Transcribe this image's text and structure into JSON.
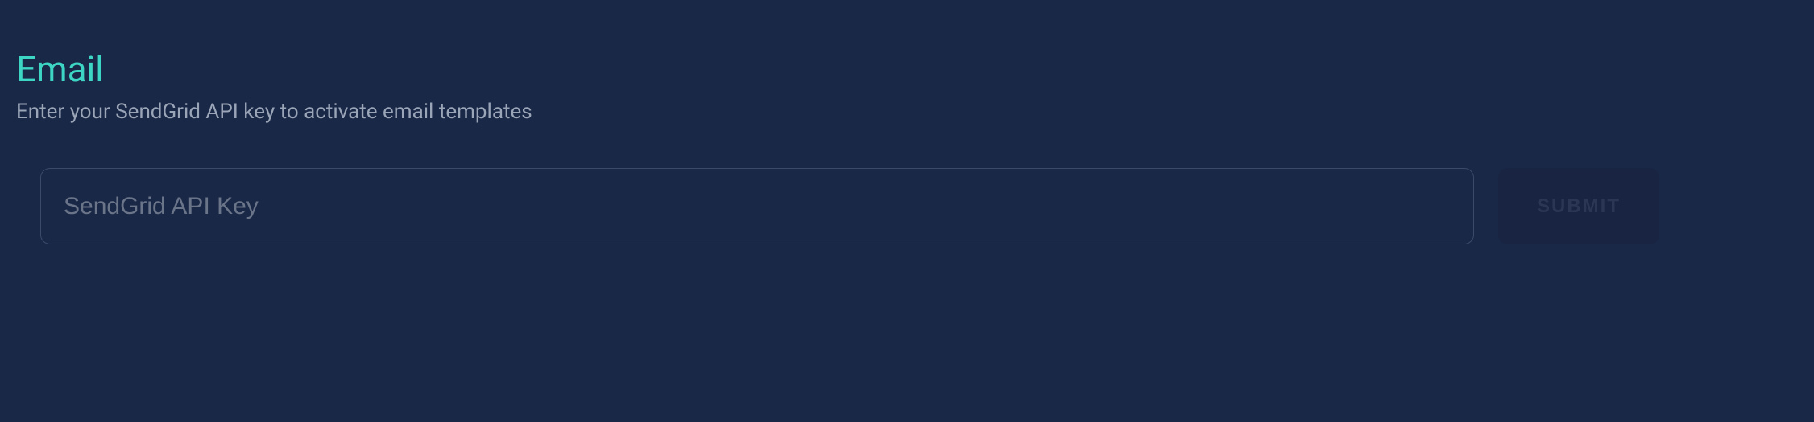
{
  "section": {
    "title": "Email",
    "description": "Enter your SendGrid API key to activate email templates"
  },
  "form": {
    "api_key_placeholder": "SendGrid API Key",
    "api_key_value": "",
    "submit_label": "SUBMIT"
  }
}
